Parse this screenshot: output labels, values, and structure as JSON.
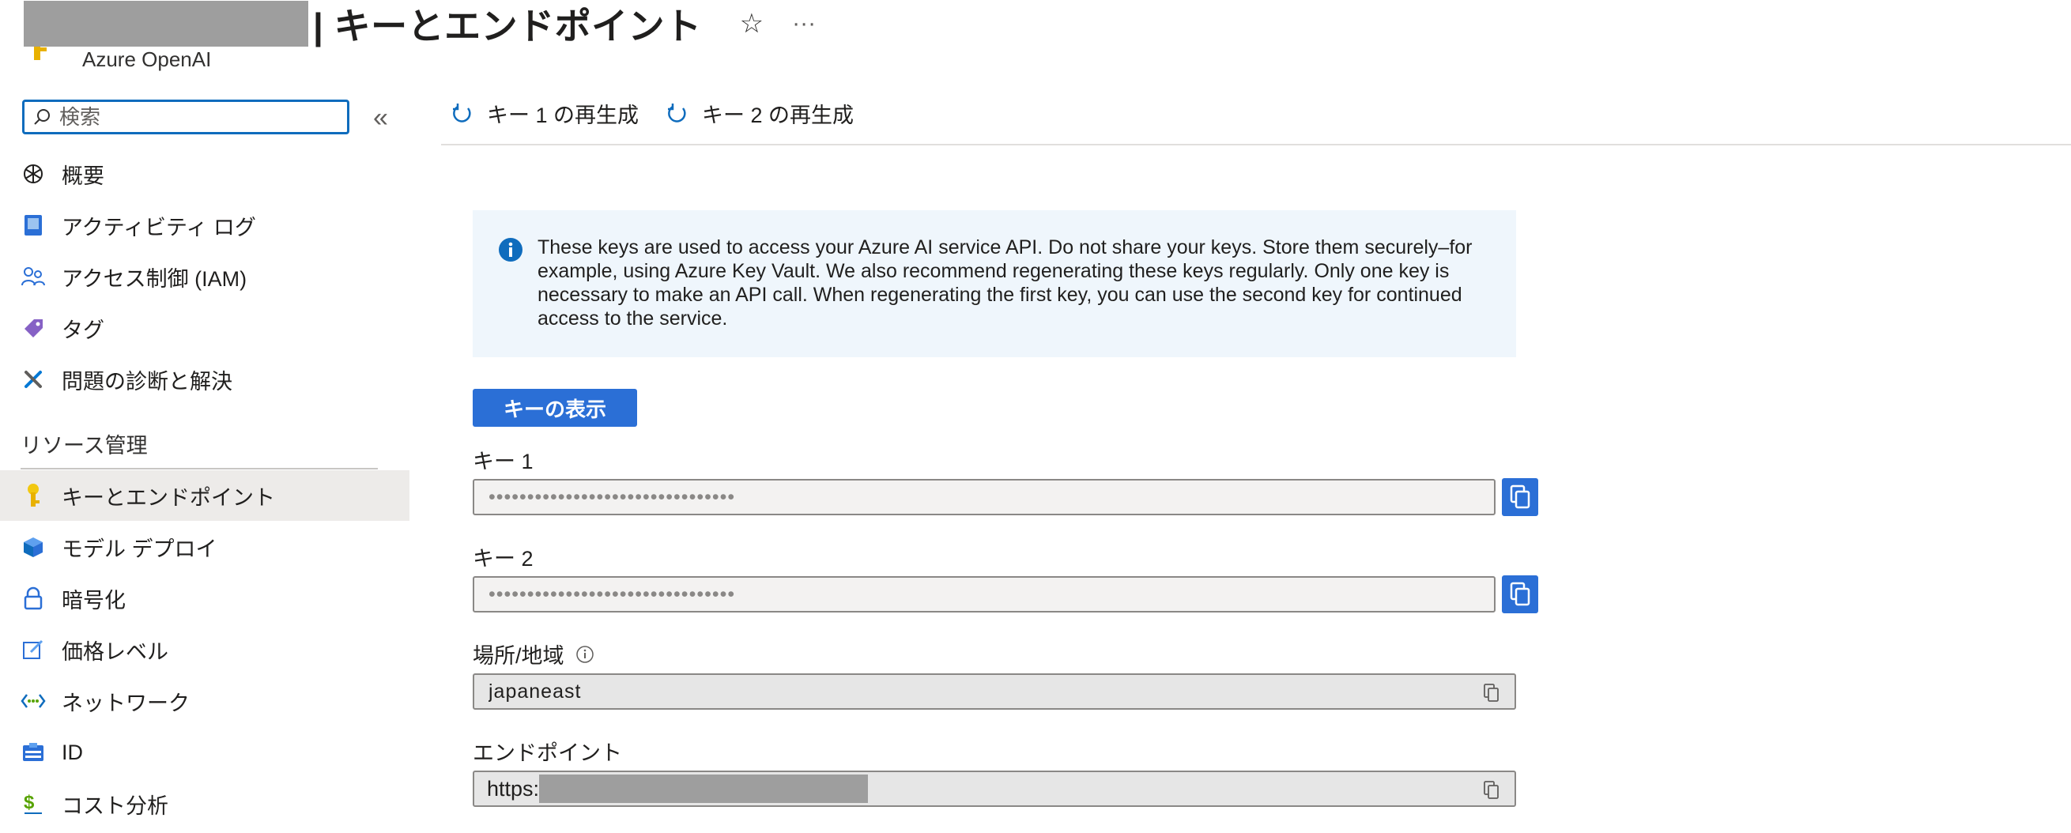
{
  "header": {
    "title": "| キーとエンドポイント",
    "subtitle": "Azure OpenAI",
    "star_icon": "☆",
    "more_icon": "···"
  },
  "search": {
    "placeholder": "検索"
  },
  "collapse_icon": "«",
  "sidebar": {
    "items": [
      {
        "label": "概要",
        "icon": "openai-icon"
      },
      {
        "label": "アクティビティ ログ",
        "icon": "activity-log-icon"
      },
      {
        "label": "アクセス制御 (IAM)",
        "icon": "people-icon"
      },
      {
        "label": "タグ",
        "icon": "tag-icon"
      },
      {
        "label": "問題の診断と解決",
        "icon": "wrench-icon"
      }
    ],
    "section_title": "リソース管理",
    "section_items": [
      {
        "label": "キーとエンドポイント",
        "icon": "key-icon",
        "active": true
      },
      {
        "label": "モデル デプロイ",
        "icon": "cube-icon"
      },
      {
        "label": "暗号化",
        "icon": "lock-icon"
      },
      {
        "label": "価格レベル",
        "icon": "edit-icon"
      },
      {
        "label": "ネットワーク",
        "icon": "network-icon"
      },
      {
        "label": "ID",
        "icon": "id-icon"
      },
      {
        "label": "コスト分析",
        "icon": "cost-icon"
      }
    ]
  },
  "toolbar": {
    "regen_key1": "キー 1 の再生成",
    "regen_key2": "キー 2 の再生成"
  },
  "info": {
    "text": "These keys are used to access your Azure AI service API. Do not share your keys. Store them securely–for example, using Azure Key Vault. We also recommend regenerating these keys regularly. Only one key is necessary to make an API call. When regenerating the first key, you can use the second key for continued access to the service."
  },
  "show_keys_label": "キーの表示",
  "fields": {
    "key1_label": "キー 1",
    "key1_value": "••••••••••••••••••••••••••••••••",
    "key2_label": "キー 2",
    "key2_value": "••••••••••••••••••••••••••••••••",
    "location_label": "場所/地域",
    "location_value": "japaneast",
    "endpoint_label": "エンドポイント",
    "endpoint_value": "https:"
  },
  "colors": {
    "accent": "#2b6fd6",
    "focus": "#0f6cbd",
    "info_bg": "#eff6fc",
    "active_bg": "#edebe9"
  }
}
